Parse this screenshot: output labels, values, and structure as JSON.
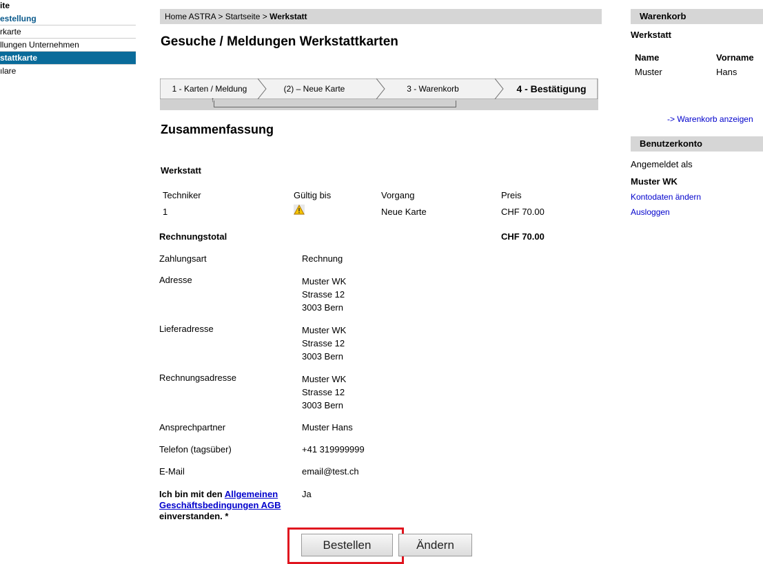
{
  "left_nav": {
    "items": [
      {
        "label": "ite",
        "style": "bold"
      },
      {
        "label": "estellung",
        "style": "blue"
      },
      {
        "label": "rkarte",
        "style": "plain"
      },
      {
        "label": "llungen Unternehmen",
        "style": "plain"
      },
      {
        "label": "stattkarte",
        "style": "active"
      },
      {
        "label": "ılare",
        "style": "plain"
      }
    ]
  },
  "breadcrumb": {
    "part1": "Home ASTRA > Startseite > ",
    "current": "Werkstatt"
  },
  "page_title": "Gesuche / Meldungen Werkstattkarten",
  "stepper": {
    "steps": [
      "1 - Karten / Meldung",
      "(2) – Neue Karte",
      "3 - Warenkorb",
      "4 - Bestätigung"
    ],
    "current_index": 3
  },
  "summary": {
    "heading": "Zusammenfassung",
    "section": "Werkstatt",
    "columns": [
      "Techniker",
      "Gültig bis",
      "Vorgang",
      "Preis"
    ],
    "row": {
      "techniker": "1",
      "gueltig_icon": "warning-icon",
      "vorgang": "Neue Karte",
      "preis": "CHF 70.00"
    },
    "total_label": "Rechnungstotal",
    "total_value": "CHF 70.00",
    "fields": {
      "zahlungsart_label": "Zahlungsart",
      "zahlungsart": "Rechnung",
      "adresse_label": "Adresse",
      "adresse": [
        "Muster WK",
        "Strasse 12",
        "3003 Bern"
      ],
      "lieferadresse_label": "Lieferadresse",
      "lieferadresse": [
        "Muster WK",
        "Strasse 12",
        "3003 Bern"
      ],
      "rechnungsadresse_label": "Rechnungsadresse",
      "rechnungsadresse": [
        "Muster WK",
        "Strasse 12",
        "3003 Bern"
      ],
      "ansprechpartner_label": "Ansprechpartner",
      "ansprechpartner": "Muster Hans",
      "telefon_label": "Telefon (tagsüber)",
      "telefon": "+41 319999999",
      "email_label": "E-Mail",
      "email": "email@test.ch"
    },
    "agb": {
      "pre": "Ich bin mit den ",
      "link": "Allgemeinen Geschäftsbedingungen AGB",
      "post": "einverstanden. *",
      "value": "Ja"
    }
  },
  "actions": {
    "order": "Bestellen",
    "change": "Ändern"
  },
  "cart": {
    "heading": "Warenkorb",
    "section": "Werkstatt",
    "col_name": "Name",
    "col_vorname": "Vorname",
    "name": "Muster",
    "vorname": "Hans",
    "show_link": "-> Warenkorb anzeigen"
  },
  "account": {
    "heading": "Benutzerkonto",
    "logged_in_as": "Angemeldet als",
    "user": "Muster WK",
    "edit_link": "Kontodaten ändern",
    "logout_link": "Ausloggen"
  },
  "colors": {
    "accent": "#0a6b9a",
    "highlight_frame": "#e0141e",
    "link": "#0000cc"
  }
}
